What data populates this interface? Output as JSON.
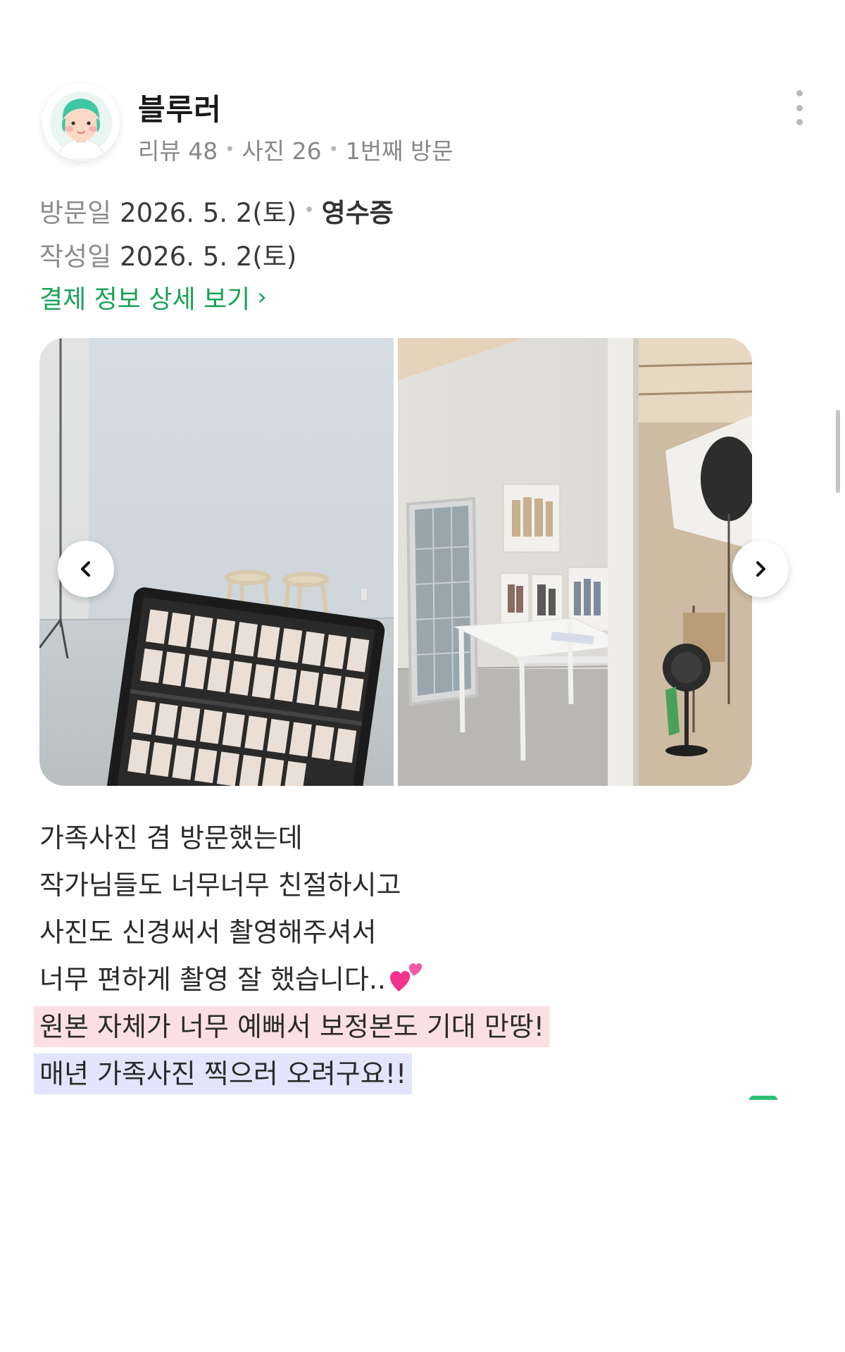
{
  "profile": {
    "username": "블루러",
    "stats": [
      "리뷰 48",
      "사진 26",
      "1번째 방문"
    ]
  },
  "meta": {
    "visit_label": "방문일",
    "visit_date": "2026. 5. 2(토)",
    "receipt_label": "영수증",
    "written_label": "작성일",
    "written_date": "2026. 5. 2(토)"
  },
  "payment_link": {
    "label": "결제 정보 상세 보기",
    "chevron": "›"
  },
  "gallery": {
    "photos": [
      {
        "icon": "studio-laptop-photo"
      },
      {
        "icon": "studio-table-portraits-photo"
      }
    ]
  },
  "review": {
    "lines": [
      "가족사진 겸 방문했는데",
      "작가님들도 너무너무 친절하시고",
      "사진도 신경써서 촬영해주셔서",
      "너무 편하게 촬영 잘 했습니다.."
    ],
    "highlight_pink": "원본 자체가 너무 예뻐서 보정본도 기대 만땅!",
    "highlight_blue": "매년 가족사진 찍으러 오려구요!!"
  },
  "colors": {
    "accent_green": "#1aa157",
    "highlight_pink": "#fbe0e3",
    "highlight_blue": "#e2e5fb"
  }
}
